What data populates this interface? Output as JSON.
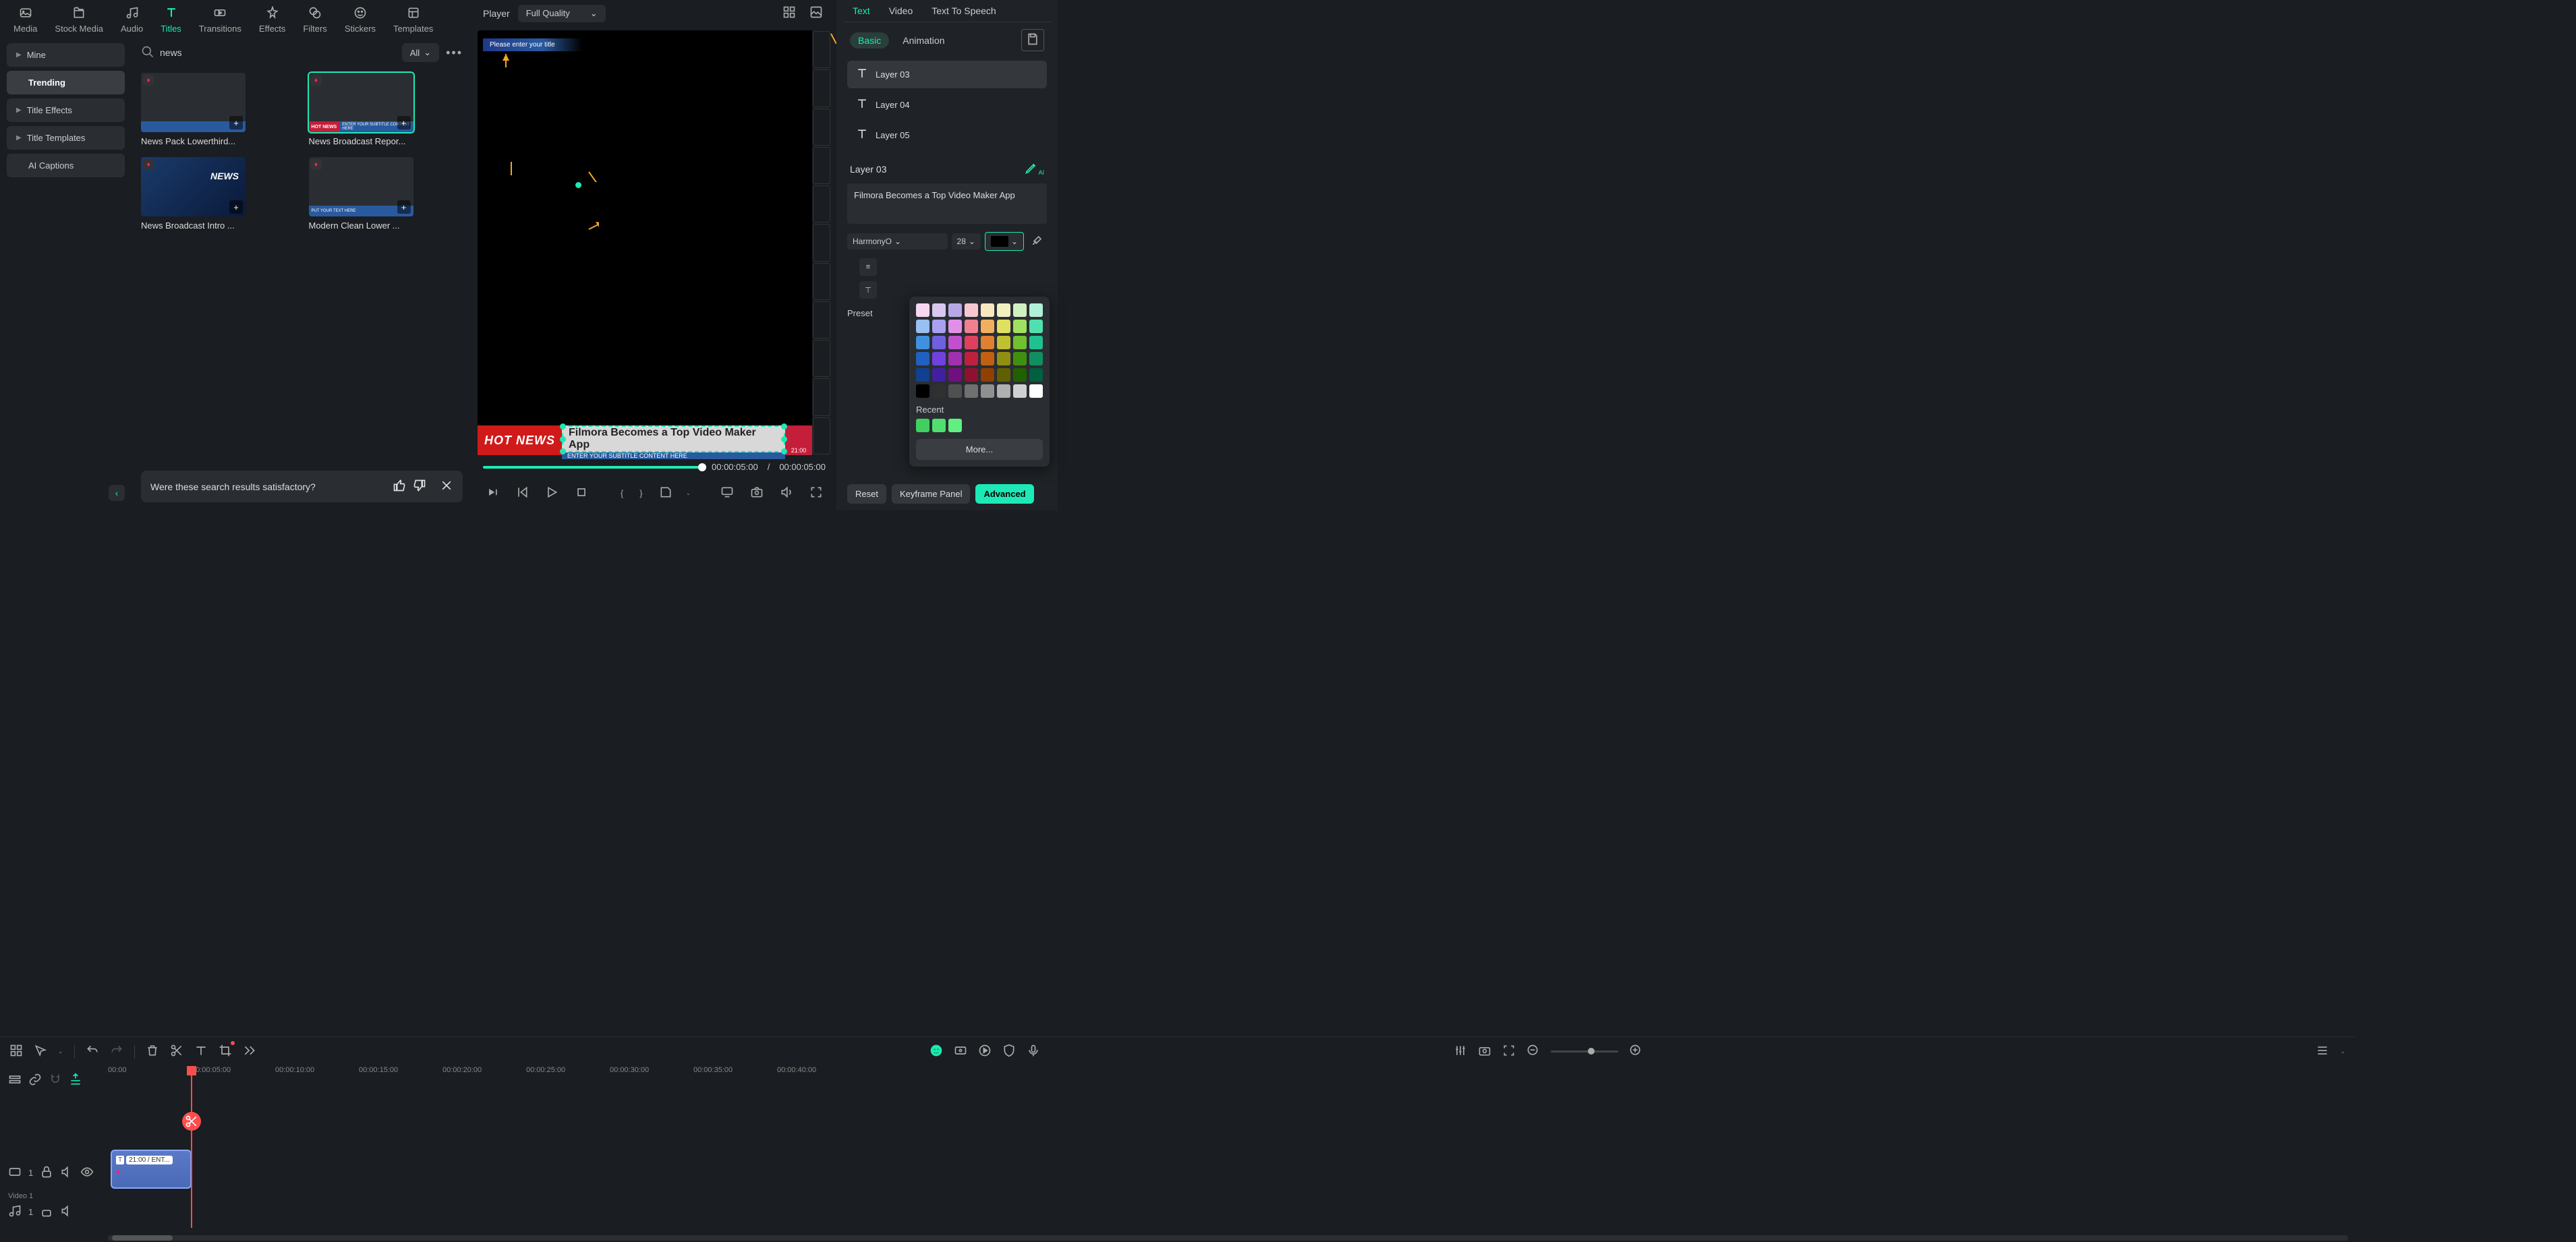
{
  "topTabs": [
    {
      "id": "media",
      "label": "Media"
    },
    {
      "id": "stock-media",
      "label": "Stock Media"
    },
    {
      "id": "audio",
      "label": "Audio"
    },
    {
      "id": "titles",
      "label": "Titles",
      "active": true
    },
    {
      "id": "transitions",
      "label": "Transitions"
    },
    {
      "id": "effects",
      "label": "Effects"
    },
    {
      "id": "filters",
      "label": "Filters"
    },
    {
      "id": "stickers",
      "label": "Stickers"
    },
    {
      "id": "templates",
      "label": "Templates"
    }
  ],
  "sidebar": {
    "items": [
      {
        "id": "mine",
        "label": "Mine",
        "expandable": true
      },
      {
        "id": "trending",
        "label": "Trending",
        "active": true
      },
      {
        "id": "title-effects",
        "label": "Title Effects",
        "expandable": true
      },
      {
        "id": "title-templates",
        "label": "Title Templates",
        "expandable": true
      },
      {
        "id": "ai-captions",
        "label": "AI Captions"
      }
    ]
  },
  "search": {
    "value": "news",
    "filter": "All"
  },
  "thumbs": [
    {
      "title": "News Pack Lowerthird...",
      "hotLabel": "",
      "sub": ""
    },
    {
      "title": "News Broadcast Repor...",
      "hotLabel": "HOT NEWS",
      "sub": "ENTER YOUR SUBTITLE CONTENT HERE",
      "selected": true
    },
    {
      "title": "News Broadcast Intro ...",
      "newsBg": true
    },
    {
      "title": "Modern Clean Lower ...",
      "hotLabel": "",
      "sub": "PUT YOUR TEXT HERE"
    }
  ],
  "feedback": {
    "text": "Were these search results satisfactory?"
  },
  "player": {
    "label": "Player",
    "quality": "Full Quality",
    "titlePlaceholder": "Please enter your title",
    "hot": "HOT NEWS",
    "headline": "Filmora Becomes a Top Video Maker App",
    "subtitle": "ENTER YOUR SUBTITLE CONTENT HERE",
    "clock": "21:00",
    "current": "00:00:05:00",
    "sep": "/",
    "total": "00:00:05:00"
  },
  "rightTabs": [
    {
      "id": "text",
      "label": "Text",
      "active": true
    },
    {
      "id": "video",
      "label": "Video"
    },
    {
      "id": "tts",
      "label": "Text To Speech"
    }
  ],
  "subTabs": [
    {
      "id": "basic",
      "label": "Basic",
      "active": true
    },
    {
      "id": "animation",
      "label": "Animation"
    }
  ],
  "layers": [
    {
      "id": "l3",
      "label": "Layer 03",
      "active": true
    },
    {
      "id": "l4",
      "label": "Layer 04"
    },
    {
      "id": "l5",
      "label": "Layer 05"
    }
  ],
  "currentLayer": {
    "name": "Layer 03",
    "text": "Filmora Becomes a Top Video Maker App",
    "font": "HarmonyO",
    "size": "28"
  },
  "colorPicker": {
    "recentLabel": "Recent",
    "more": "More...",
    "grid": [
      "#f8d7f0",
      "#d8c8f0",
      "#b8a8e8",
      "#f8c8d0",
      "#f8e8c0",
      "#f0f0c0",
      "#d0f0c0",
      "#b0f0d8",
      "#98c0f0",
      "#a8a0f0",
      "#e090e8",
      "#f08090",
      "#f0b060",
      "#e0e060",
      "#a0e060",
      "#50e0b0",
      "#4090e0",
      "#7060e0",
      "#c050d0",
      "#e04060",
      "#e08030",
      "#c0c030",
      "#70c030",
      "#20c090",
      "#2060c0",
      "#7040e0",
      "#a030b0",
      "#c02040",
      "#c06010",
      "#909010",
      "#409010",
      "#109060",
      "#104090",
      "#4020a0",
      "#701080",
      "#901030",
      "#904000",
      "#606000",
      "#206000",
      "#006040",
      "#000000",
      "#303030",
      "#505050",
      "#707070",
      "#909090",
      "#b0b0b0",
      "#d0d0d0",
      "#ffffff"
    ],
    "recent": [
      "#40d060",
      "#50e070",
      "#60f080"
    ]
  },
  "presetLabel": "Preset",
  "buttons": {
    "reset": "Reset",
    "keyframe": "Keyframe Panel",
    "advanced": "Advanced"
  },
  "timeline": {
    "ticks": [
      "00:00",
      "00:00:05:00",
      "00:00:10:00",
      "00:00:15:00",
      "00:00:20:00",
      "00:00:25:00",
      "00:00:30:00",
      "00:00:35:00",
      "00:00:40:00"
    ],
    "trackLabel": "Video 1",
    "track1Badge": "1",
    "clipLabel": "21:00 / ENT..."
  }
}
